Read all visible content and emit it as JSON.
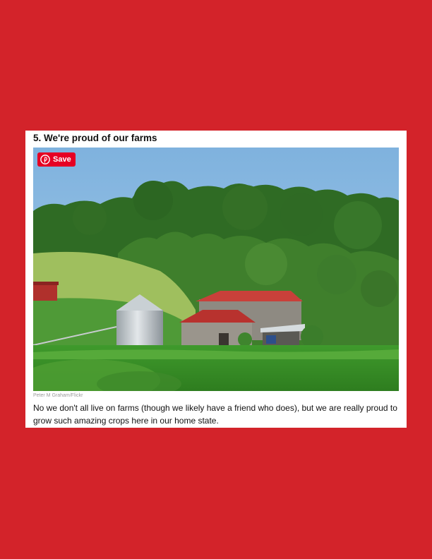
{
  "article": {
    "heading": "5. We're proud of our farms",
    "save_label": "Save",
    "photo_credit": "Peter M Graham/Flickr",
    "caption": "No we don't all live on farms (though we likely have a friend who does), but we are really proud to grow such amazing crops here in our home state."
  },
  "icons": {
    "save": "pinterest-icon"
  },
  "colors": {
    "page_background": "#d3232a",
    "save_button": "#e60023"
  }
}
